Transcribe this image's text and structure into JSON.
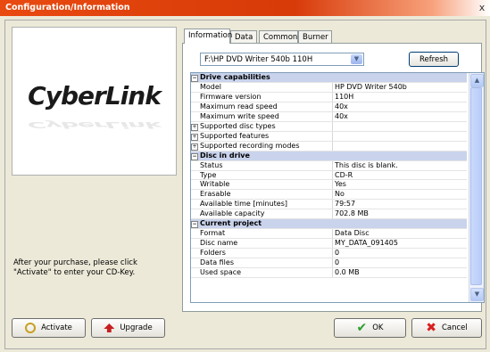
{
  "window": {
    "title": "Configuration/Information",
    "close_glyph": "x"
  },
  "brand": {
    "logo_text": "CyberLink"
  },
  "purchase_message": "After your purchase, please click \"Activate\" to enter your CD-Key.",
  "tabs": [
    {
      "label": "Information",
      "active": true
    },
    {
      "label": "Data",
      "active": false
    },
    {
      "label": "Common",
      "active": false
    },
    {
      "label": "Burner",
      "active": false
    }
  ],
  "drive_select": {
    "value": "F:\\HP DVD Writer 540b 110H"
  },
  "refresh_label": "Refresh",
  "properties": [
    {
      "type": "category",
      "label": "Drive capabilities"
    },
    {
      "type": "row",
      "name": "Model",
      "value": "HP     DVD Writer 540b"
    },
    {
      "type": "row",
      "name": "Firmware version",
      "value": "110H"
    },
    {
      "type": "row",
      "name": "Maximum read speed",
      "value": "40x"
    },
    {
      "type": "row",
      "name": "Maximum write speed",
      "value": "40x"
    },
    {
      "type": "group",
      "name": "Supported disc types",
      "value": ""
    },
    {
      "type": "group",
      "name": "Supported features",
      "value": ""
    },
    {
      "type": "group",
      "name": "Supported recording modes",
      "value": ""
    },
    {
      "type": "category",
      "label": "Disc in drive"
    },
    {
      "type": "row",
      "name": "Status",
      "value": "This disc is blank."
    },
    {
      "type": "row",
      "name": "Type",
      "value": "CD-R"
    },
    {
      "type": "row",
      "name": "Writable",
      "value": "Yes"
    },
    {
      "type": "row",
      "name": "Erasable",
      "value": "No"
    },
    {
      "type": "row",
      "name": "Available time [minutes]",
      "value": "79:57"
    },
    {
      "type": "row",
      "name": "Available capacity",
      "value": "702.8 MB"
    },
    {
      "type": "category",
      "label": "Current project"
    },
    {
      "type": "row",
      "name": "Format",
      "value": "Data Disc"
    },
    {
      "type": "row",
      "name": "Disc name",
      "value": "MY_DATA_091405"
    },
    {
      "type": "row",
      "name": "Folders",
      "value": "0"
    },
    {
      "type": "row",
      "name": "Data files",
      "value": "0"
    },
    {
      "type": "row",
      "name": "Used space",
      "value": "0.0 MB"
    }
  ],
  "buttons": {
    "activate": "Activate",
    "upgrade": "Upgrade",
    "ok": "OK",
    "cancel": "Cancel"
  },
  "icons": {
    "activate": "key-icon",
    "upgrade": "upgrade-arrow-icon",
    "ok": "checkmark-icon",
    "cancel": "red-x-icon"
  },
  "colors": {
    "titlebar": "#e84a10",
    "category_row": "#c9d3ec",
    "window_bg": "#ece9d8"
  }
}
